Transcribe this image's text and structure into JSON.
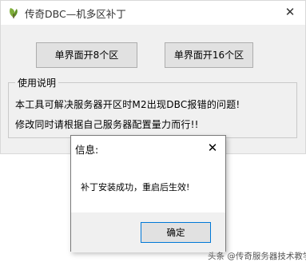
{
  "main_window": {
    "title": "传奇DBC—机多区补丁",
    "close_glyph": "✕",
    "buttons": {
      "single_8": "单界面开8个区",
      "single_16": "单界面开16个区"
    },
    "usage": {
      "legend": "使用说明",
      "line1": "本工具可解决服务器开区时M2出现DBC报错的问题!",
      "line2": "修改同时请根据自己服务器配置量力而行!!"
    }
  },
  "dialog": {
    "title": "信息:",
    "close_glyph": "✕",
    "message": "补丁安装成功，重启后生效!",
    "ok_label": "确定"
  },
  "watermark": "头条 @传奇服务器技术教学"
}
